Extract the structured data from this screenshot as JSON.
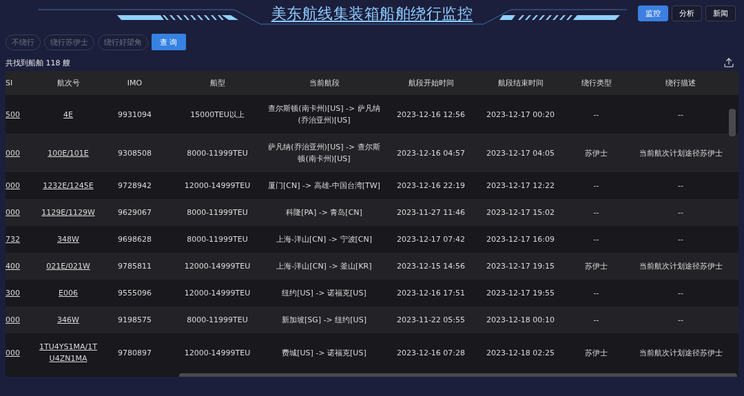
{
  "header": {
    "title": "美东航线集装箱船舶绕行监控"
  },
  "nav": [
    {
      "label": "监控",
      "selected": true
    },
    {
      "label": "分析",
      "selected": false
    },
    {
      "label": "新闻",
      "selected": false
    }
  ],
  "filters": [
    {
      "label": "不绕行",
      "selected": false
    },
    {
      "label": "绕行苏伊士",
      "selected": false
    },
    {
      "label": "绕行好望角",
      "selected": false
    }
  ],
  "query_button": "查 询",
  "result_count": "共找到船舶 118 艘",
  "table": {
    "columns": [
      "SI",
      "航次号",
      "IMO",
      "船型",
      "当前航段",
      "航段开始时间",
      "航段结束时间",
      "绕行类型",
      "绕行描述"
    ],
    "rows": [
      [
        "500",
        "4E",
        "9931094",
        "15000TEU以上",
        "查尔斯顿(南卡州)[US] -> 萨凡纳(乔治亚州)[US]",
        "2023-12-16 12:56",
        "2023-12-17 00:20",
        "--",
        "--"
      ],
      [
        "000",
        "100E/101E",
        "9308508",
        "8000-11999TEU",
        "萨凡纳(乔治亚州)[US] -> 查尔斯顿(南卡州)[US]",
        "2023-12-16 04:57",
        "2023-12-17 04:05",
        "苏伊士",
        "当前航次计划途径苏伊士"
      ],
      [
        "000",
        "1232E/1245E",
        "9728942",
        "12000-14999TEU",
        "厦门[CN] -> 高雄-中国台湾[TW]",
        "2023-12-16 22:19",
        "2023-12-17 12:22",
        "--",
        "--"
      ],
      [
        "000",
        "1129E/1129W",
        "9629067",
        "8000-11999TEU",
        "科隆[PA] -> 青岛[CN]",
        "2023-11-27 11:46",
        "2023-12-17 15:02",
        "--",
        "--"
      ],
      [
        "732",
        "348W",
        "9698628",
        "8000-11999TEU",
        "上海-洋山[CN] -> 宁波[CN]",
        "2023-12-17 07:42",
        "2023-12-17 16:09",
        "--",
        "--"
      ],
      [
        "400",
        "021E/021W",
        "9785811",
        "12000-14999TEU",
        "上海-洋山[CN] -> 釜山[KR]",
        "2023-12-15 14:56",
        "2023-12-17 19:15",
        "苏伊士",
        "当前航次计划途径苏伊士"
      ],
      [
        "300",
        "E006",
        "9555096",
        "12000-14999TEU",
        "纽约[US] -> 诺福克[US]",
        "2023-12-16 17:51",
        "2023-12-17 19:55",
        "--",
        "--"
      ],
      [
        "000",
        "346W",
        "9198575",
        "8000-11999TEU",
        "新加坡[SG] -> 纽约[US]",
        "2023-11-22 05:55",
        "2023-12-18 00:10",
        "--",
        "--"
      ],
      [
        "000",
        "1TU4YS1MA/1TU4ZN1MA",
        "9780897",
        "12000-14999TEU",
        "费城[US] -> 诺福克[US]",
        "2023-12-16 07:28",
        "2023-12-18 02:25",
        "苏伊士",
        "当前航次计划途径苏伊士"
      ]
    ]
  }
}
